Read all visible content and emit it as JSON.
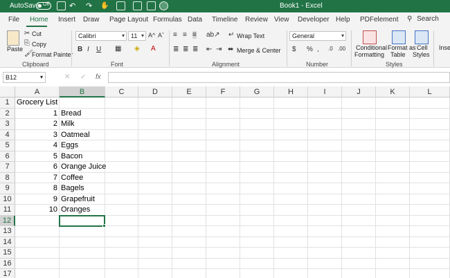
{
  "titlebar": {
    "autosave_label": "AutoSave",
    "autosave_state": "Off",
    "document_title": "Book1  -  Excel"
  },
  "tabs": [
    "File",
    "Home",
    "Insert",
    "Draw",
    "Page Layout",
    "Formulas",
    "Data",
    "Timeline",
    "Review",
    "View",
    "Developer",
    "Help",
    "PDFelement"
  ],
  "active_tab": "Home",
  "search_label": "Search",
  "ribbon": {
    "clipboard": {
      "paste": "Paste",
      "cut": "Cut",
      "copy": "Copy",
      "format_painter": "Format Painter",
      "label": "Clipboard"
    },
    "font": {
      "font_name": "Calibri",
      "font_size": "11",
      "label": "Font"
    },
    "alignment": {
      "wrap_text": "Wrap Text",
      "merge_center": "Merge & Center",
      "label": "Alignment"
    },
    "number": {
      "format": "General",
      "label": "Number"
    },
    "styles": {
      "conditional_1": "Conditional",
      "conditional_2": "Formatting",
      "format_as_1": "Format as",
      "format_as_2": "Table",
      "cell_1": "Cell",
      "cell_2": "Styles",
      "label": "Styles"
    },
    "insert_partial": "Inser"
  },
  "formula_bar": {
    "name_box": "B12",
    "formula": ""
  },
  "grid": {
    "columns": [
      "A",
      "B",
      "C",
      "D",
      "E",
      "F",
      "G",
      "H",
      "I",
      "J",
      "K",
      "L"
    ],
    "rows": [
      "1",
      "2",
      "3",
      "4",
      "5",
      "6",
      "7",
      "8",
      "9",
      "10",
      "11",
      "12",
      "13",
      "14",
      "15",
      "16",
      "17"
    ],
    "selected_cell": "B12",
    "cells": {
      "A1": "Grocery List",
      "A2": "1",
      "B2": "Bread",
      "A3": "2",
      "B3": "Milk",
      "A4": "3",
      "B4": "Oatmeal",
      "A5": "4",
      "B5": "Eggs",
      "A6": "5",
      "B6": "Bacon",
      "A7": "6",
      "B7": "Orange Juice",
      "A8": "7",
      "B8": "Coffee",
      "A9": "8",
      "B9": "Bagels",
      "A10": "9",
      "B10": "Grapefruit",
      "A11": "10",
      "B11": "Oranges"
    }
  },
  "colors": {
    "accent": "#217346",
    "ribbon_bg": "#f3f3f3",
    "gridline": "#e1e1e1"
  }
}
